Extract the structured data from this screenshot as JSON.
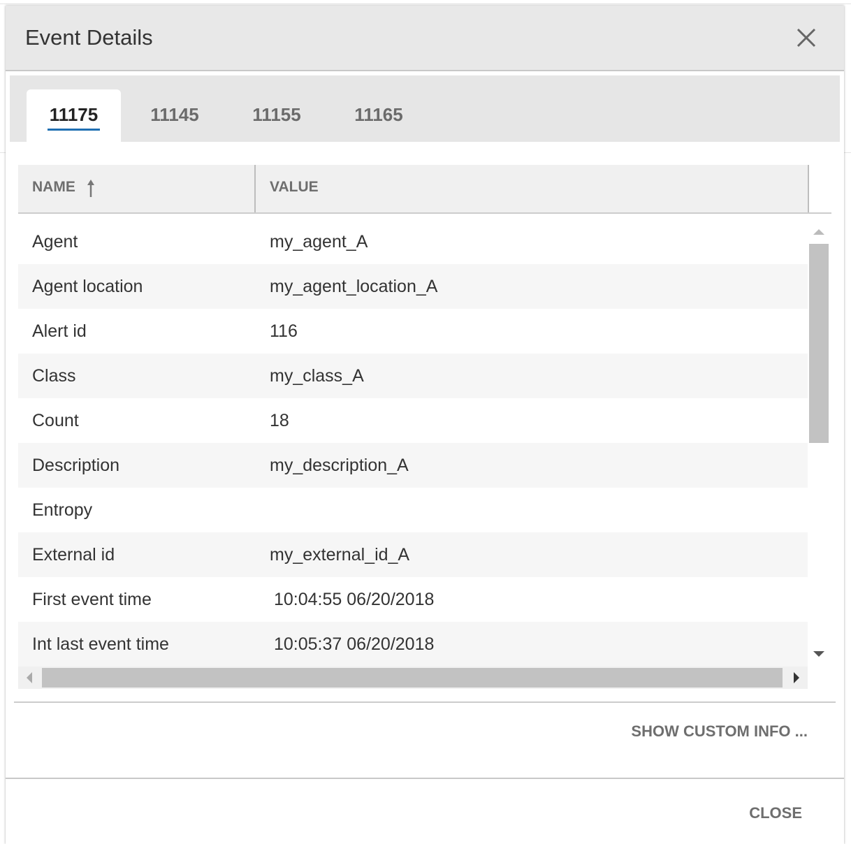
{
  "dialog": {
    "title": "Event Details",
    "close_icon": "close-icon"
  },
  "tabs": [
    {
      "label": "11175",
      "active": true
    },
    {
      "label": "11145",
      "active": false
    },
    {
      "label": "11155",
      "active": false
    },
    {
      "label": "11165",
      "active": false
    }
  ],
  "table": {
    "columns": [
      {
        "label": "NAME",
        "sort": "ascending",
        "sort_icon": "arrow-up-icon"
      },
      {
        "label": "VALUE"
      }
    ],
    "rows": [
      {
        "name": "Agent",
        "value": "my_agent_A"
      },
      {
        "name": "Agent location",
        "value": "my_agent_location_A"
      },
      {
        "name": "Alert id",
        "value": "116"
      },
      {
        "name": "Class",
        "value": "my_class_A"
      },
      {
        "name": "Count",
        "value": "18"
      },
      {
        "name": "Description",
        "value": "my_description_A"
      },
      {
        "name": "Entropy",
        "value": ""
      },
      {
        "name": "External id",
        "value": "my_external_id_A"
      },
      {
        "name": "First event time",
        "value": "10:04:55 06/20/2018"
      },
      {
        "name": "Int last event time",
        "value": "10:05:37 06/20/2018"
      }
    ]
  },
  "links": {
    "show_custom_info": "SHOW CUSTOM INFO ..."
  },
  "footer": {
    "close_label": "CLOSE"
  },
  "colors": {
    "header_bg": "#e8e8e8",
    "tab_underline": "#1f6fb2",
    "row_alt": "#f6f6f6",
    "scroll_thumb": "#c2c2c2"
  }
}
